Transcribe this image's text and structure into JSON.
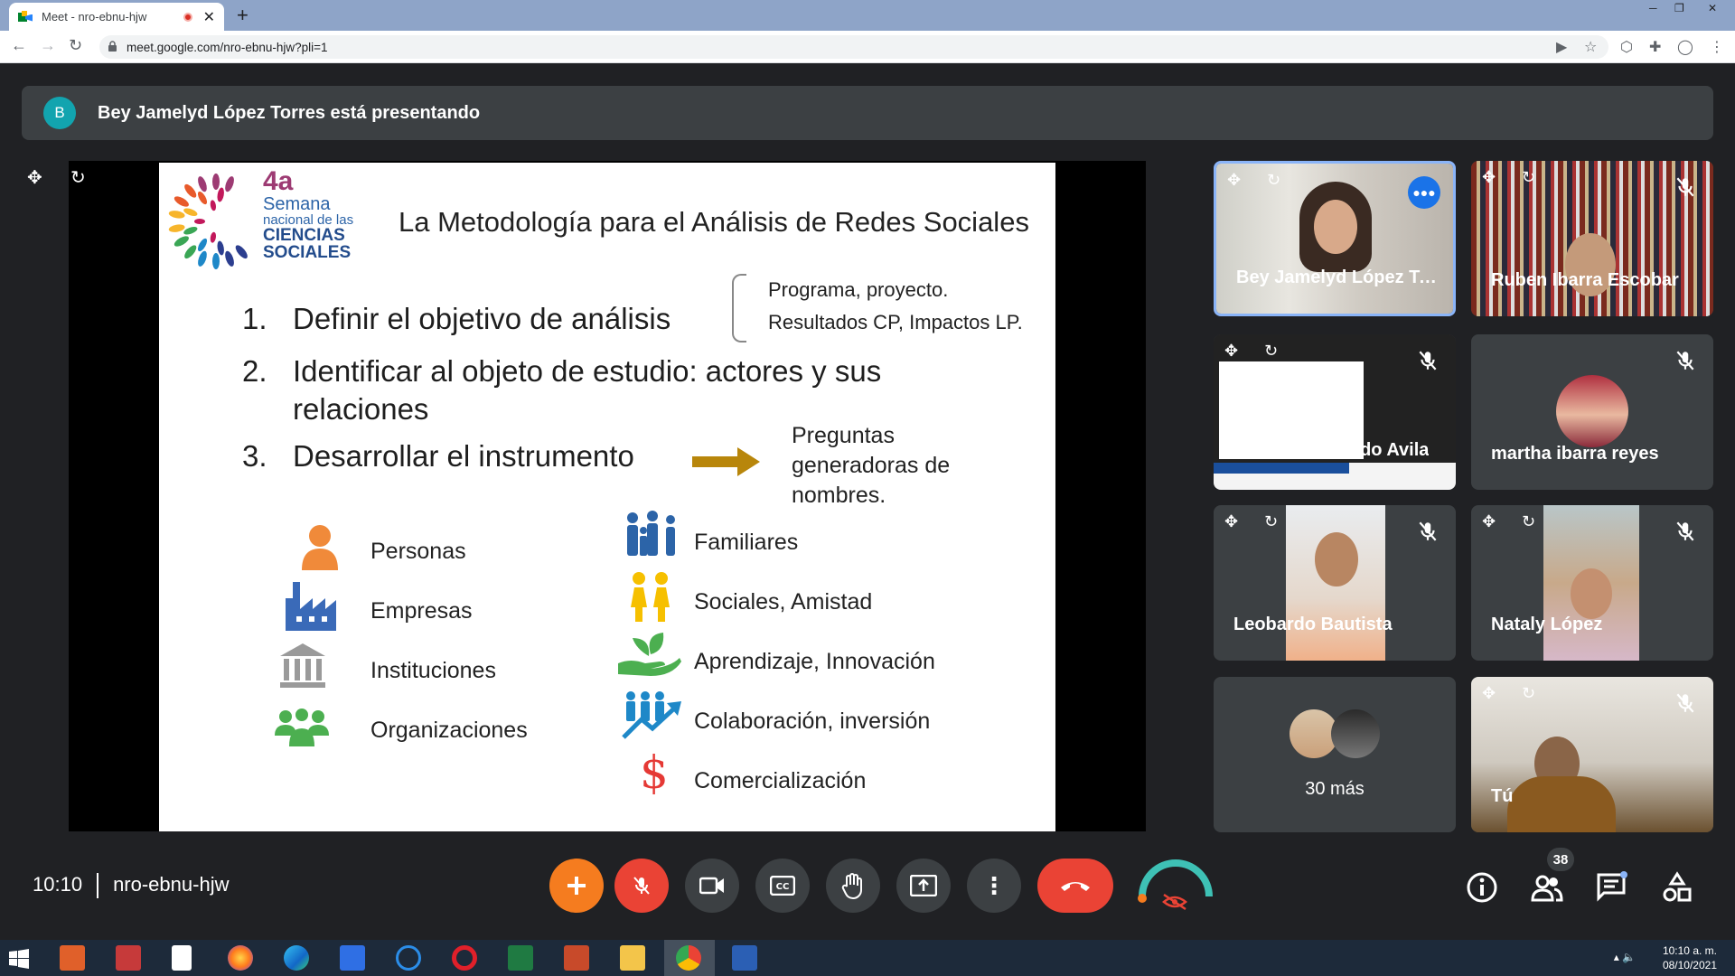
{
  "browser": {
    "tab_title": "Meet - nro-ebnu-hjw",
    "url": "meet.google.com/nro-ebnu-hjw?pli=1"
  },
  "banner": {
    "avatar_letter": "B",
    "text": "Bey Jamelyd López Torres está presentando"
  },
  "slide": {
    "title": "La Metodología para el Análisis de Redes Sociales",
    "logo": {
      "number": "4a",
      "line1": "Semana",
      "line2": "nacional de las",
      "line3": "CIENCIAS",
      "line4": "SOCIALES"
    },
    "items": [
      {
        "num": "1.",
        "text": "Definir el objetivo de análisis"
      },
      {
        "num": "2.",
        "text": "Identificar al objeto de estudio: actores y sus",
        "text2": "relaciones"
      },
      {
        "num": "3.",
        "text": "Desarrollar el instrumento"
      }
    ],
    "side1": "Programa, proyecto.",
    "side2": "Resultados CP, Impactos LP.",
    "preguntas": "Preguntas generadoras de nombres.",
    "left_categories": [
      "Personas",
      "Empresas",
      "Instituciones",
      "Organizaciones"
    ],
    "right_categories": [
      "Familiares",
      "Sociales, Amistad",
      "Aprendizaje, Innovación",
      "Colaboración, inversión",
      "Comercialización"
    ]
  },
  "participants": [
    {
      "name": "Bey Jamelyd López Torres"
    },
    {
      "name": "Ruben Ibarra Escobar"
    },
    {
      "name": "Primario Gerardo Avila"
    },
    {
      "name": "martha ibarra reyes"
    },
    {
      "name": "Leobardo Bautista"
    },
    {
      "name": "Nataly López"
    },
    {
      "name": "30 más"
    },
    {
      "name": "Tú"
    }
  ],
  "bottom": {
    "time": "10:10",
    "meeting_code": "nro-ebnu-hjw",
    "people_count": "38"
  },
  "tray": {
    "time": "10:10 a. m.",
    "date": "08/10/2021"
  },
  "colors": {
    "accent_red": "#ea4335",
    "meet_dark": "#202124",
    "tile": "#3c4043"
  }
}
